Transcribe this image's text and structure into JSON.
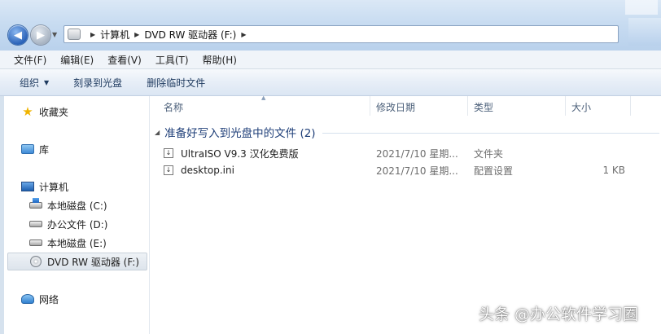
{
  "address": {
    "breadcrumbs": [
      "计算机",
      "DVD RW 驱动器 (F:)"
    ]
  },
  "menu": [
    "文件(F)",
    "编辑(E)",
    "查看(V)",
    "工具(T)",
    "帮助(H)"
  ],
  "toolbar": {
    "organize": "组织",
    "burn": "刻录到光盘",
    "delete_temp": "删除临时文件"
  },
  "sidebar": {
    "favorites": "收藏夹",
    "libraries": "库",
    "computer": "计算机",
    "drives": [
      {
        "label": "本地磁盘 (C:)"
      },
      {
        "label": "办公文件 (D:)"
      },
      {
        "label": "本地磁盘 (E:)"
      },
      {
        "label": "DVD RW 驱动器 (F:)"
      }
    ],
    "network": "网络"
  },
  "columns": {
    "name": "名称",
    "date": "修改日期",
    "type": "类型",
    "size": "大小"
  },
  "group": {
    "title": "准备好写入到光盘中的文件 (2)"
  },
  "files": [
    {
      "name": "UltraISO V9.3 汉化免费版",
      "date": "2021/7/10 星期...",
      "type": "文件夹",
      "size": ""
    },
    {
      "name": "desktop.ini",
      "date": "2021/7/10 星期...",
      "type": "配置设置",
      "size": "1 KB"
    }
  ],
  "watermark": "头条 @办公软件学习圈"
}
